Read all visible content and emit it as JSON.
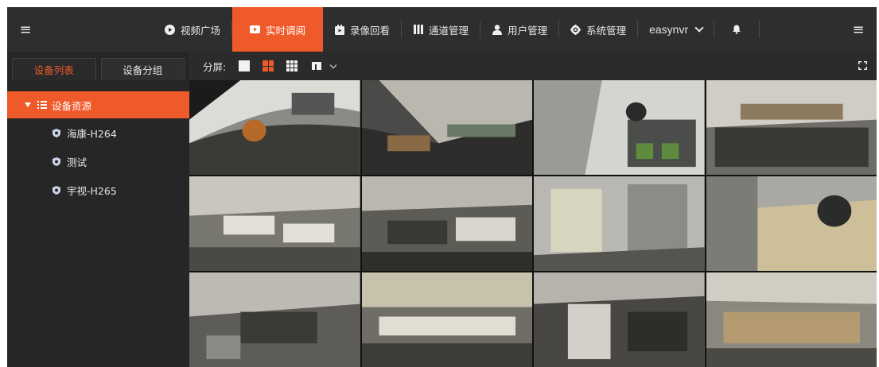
{
  "topbar": {
    "nav": [
      {
        "label": "视频广场",
        "icon": "play-circle-icon"
      },
      {
        "label": "实时调阅",
        "icon": "video-camera-icon",
        "active": true
      },
      {
        "label": "录像回看",
        "icon": "recording-icon"
      },
      {
        "label": "通道管理",
        "icon": "channel-icon"
      },
      {
        "label": "用户管理",
        "icon": "user-icon"
      },
      {
        "label": "系统管理",
        "icon": "gear-icon"
      }
    ],
    "user": "easynvr",
    "accent": "#ef5a2a"
  },
  "sidebar": {
    "tabs": [
      {
        "label": "设备列表",
        "active": true
      },
      {
        "label": "设备分组",
        "active": false
      }
    ],
    "tree": {
      "root": "设备资源",
      "items": [
        "海康-H264",
        "测试",
        "宇视-H265"
      ]
    }
  },
  "toolbar": {
    "split_label": "分屏:",
    "selected_split": "4"
  },
  "grid": {
    "rows": 3,
    "cols": 4,
    "cell_count": 12
  }
}
